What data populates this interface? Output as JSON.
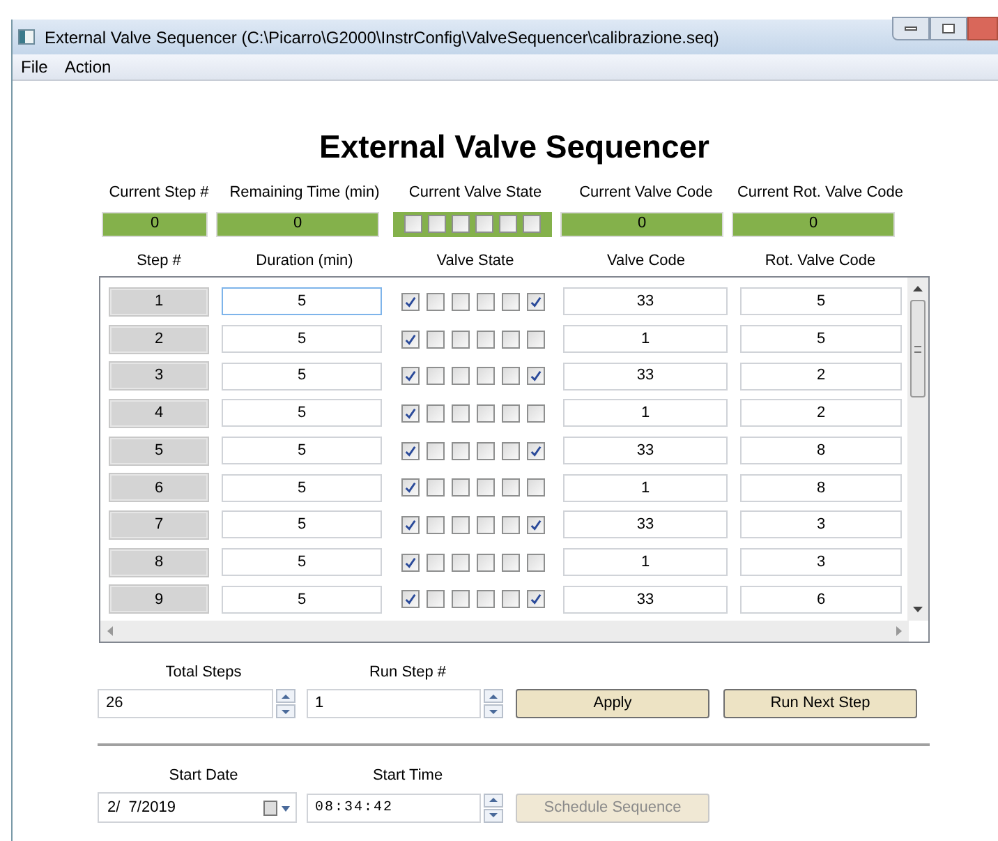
{
  "window": {
    "title": "External Valve Sequencer (C:\\Picarro\\G2000\\InstrConfig\\ValveSequencer\\calibrazione.seq)"
  },
  "menu": [
    "File",
    "Action"
  ],
  "heading": "External Valve Sequencer",
  "status": {
    "labels": [
      "Current Step #",
      "Remaining Time (min)",
      "Current Valve State",
      "Current Valve Code",
      "Current Rot. Valve Code"
    ],
    "current_step": "0",
    "remaining_time": "0",
    "current_valves": [
      false,
      false,
      false,
      false,
      false,
      false
    ],
    "valve_code": "0",
    "rot_valve_code": "0"
  },
  "table": {
    "columns": [
      "Step #",
      "Duration (min)",
      "Valve State",
      "Valve Code",
      "Rot. Valve Code"
    ],
    "rows": [
      {
        "step": "1",
        "duration": "5",
        "valves": [
          true,
          false,
          false,
          false,
          false,
          true
        ],
        "valve_code": "33",
        "rot_valve_code": "5",
        "focused": true
      },
      {
        "step": "2",
        "duration": "5",
        "valves": [
          true,
          false,
          false,
          false,
          false,
          false
        ],
        "valve_code": "1",
        "rot_valve_code": "5",
        "focused": false
      },
      {
        "step": "3",
        "duration": "5",
        "valves": [
          true,
          false,
          false,
          false,
          false,
          true
        ],
        "valve_code": "33",
        "rot_valve_code": "2",
        "focused": false
      },
      {
        "step": "4",
        "duration": "5",
        "valves": [
          true,
          false,
          false,
          false,
          false,
          false
        ],
        "valve_code": "1",
        "rot_valve_code": "2",
        "focused": false
      },
      {
        "step": "5",
        "duration": "5",
        "valves": [
          true,
          false,
          false,
          false,
          false,
          true
        ],
        "valve_code": "33",
        "rot_valve_code": "8",
        "focused": false
      },
      {
        "step": "6",
        "duration": "5",
        "valves": [
          true,
          false,
          false,
          false,
          false,
          false
        ],
        "valve_code": "1",
        "rot_valve_code": "8",
        "focused": false
      },
      {
        "step": "7",
        "duration": "5",
        "valves": [
          true,
          false,
          false,
          false,
          false,
          true
        ],
        "valve_code": "33",
        "rot_valve_code": "3",
        "focused": false
      },
      {
        "step": "8",
        "duration": "5",
        "valves": [
          true,
          false,
          false,
          false,
          false,
          false
        ],
        "valve_code": "1",
        "rot_valve_code": "3",
        "focused": false
      },
      {
        "step": "9",
        "duration": "5",
        "valves": [
          true,
          false,
          false,
          false,
          false,
          true
        ],
        "valve_code": "33",
        "rot_valve_code": "6",
        "focused": false
      }
    ]
  },
  "controls": {
    "total_steps_label": "Total Steps",
    "total_steps": "26",
    "run_step_label": "Run Step #",
    "run_step": "1",
    "buttons": [
      {
        "label": "Apply",
        "disabled": false
      },
      {
        "label": "Run Next Step",
        "disabled": false
      }
    ],
    "start_date_label": "Start Date",
    "start_date": "2/  7/2019",
    "start_time_label": "Start Time",
    "start_time": "08:34:42",
    "schedule_button": {
      "label": "Schedule Sequence",
      "disabled": true
    }
  }
}
